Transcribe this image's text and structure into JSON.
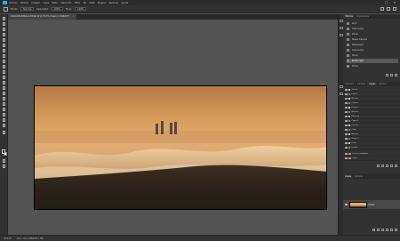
{
  "menubar": {
    "items": [
      "Archivo",
      "Edición",
      "Imagen",
      "Capa",
      "Texto",
      "Selección",
      "Filtro",
      "3D",
      "Vista",
      "Plugins",
      "Ventana",
      "Ayuda"
    ]
  },
  "optionsbar": {
    "mode_label": "Modo:",
    "mode_value": "Normal",
    "opacity_label": "Opacidad:",
    "opacity_value": "100%",
    "flow_label": "Flujo:",
    "flow_value": "100%"
  },
  "document": {
    "tab_title": "DSC0129-Editar-2-Editar.tif @ 33,3% (Capa 1, RGB/16*)",
    "tab_close": "×"
  },
  "statusbar": {
    "zoom": "33,33%",
    "doc_info": "Doc: 125,2 MB/593,7 MB"
  },
  "history_panel": {
    "tabs": [
      "Historia",
      "Propiedades"
    ],
    "items": [
      "Abrir",
      "Capa nueva",
      "Pincel",
      "Nueva máscara",
      "Desagrupar",
      "Capa nueva",
      "Pincel",
      "Borrar capa",
      "Pincel"
    ],
    "selected_index": 7
  },
  "layers_panel": {
    "tabs": [
      "Trazados",
      "Canales",
      "Capas",
      "Ajustes"
    ],
    "rows": [
      "Viñeta",
      "Capa 5",
      "Niveles",
      "Curvas",
      "Curvas",
      "Niveles",
      "Máscara",
      "Capa 4",
      "Curvas",
      "Color",
      "Ajustes",
      "Grupo 1",
      "Cielo",
      "Fondo"
    ],
    "folders": [
      "Luces y sombras",
      "Color"
    ],
    "bottom_tabs": [
      "Capas",
      "Canales"
    ],
    "main_layer_name": "Fondo"
  },
  "colors": {
    "accent": "#31a8ff",
    "workspace": "#535353",
    "panel_bg": "#323232",
    "selected_row": "#5a5a5a"
  }
}
